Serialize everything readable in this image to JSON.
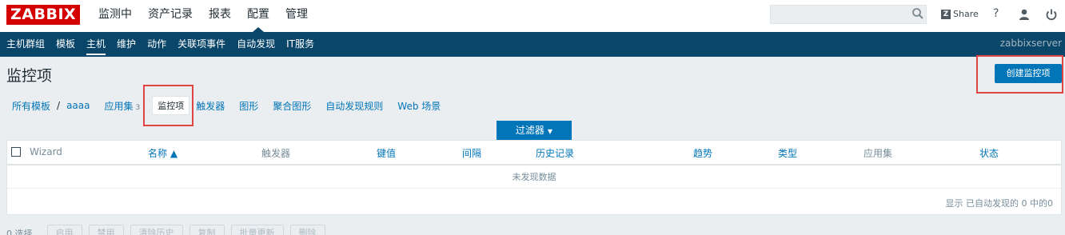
{
  "logo": "ZABBIX",
  "top_nav": [
    "监测中",
    "资产记录",
    "报表",
    "配置",
    "管理"
  ],
  "top_nav_active": "配置",
  "search": {
    "value": "",
    "placeholder": ""
  },
  "share_label": "Share",
  "help_label": "?",
  "sub_nav": [
    "主机群组",
    "模板",
    "主机",
    "维护",
    "动作",
    "关联项事件",
    "自动发现",
    "IT服务"
  ],
  "sub_nav_active": "主机",
  "server_name": "zabbixserver",
  "page_title": "监控项",
  "create_button": "创建监控项",
  "breadcrumb": {
    "all_templates": "所有模板",
    "separator": "/",
    "host": "aaaa",
    "applications": "应用集",
    "applications_count": "3",
    "items": "监控项",
    "triggers": "触发器",
    "graphs": "图形",
    "screens": "聚合图形",
    "discovery": "自动发现规则",
    "web": "Web 场景"
  },
  "filter_label": "过滤器",
  "table": {
    "columns": [
      "Wizard",
      "名称 ▲",
      "触发器",
      "键值",
      "间隔",
      "历史记录",
      "趋势",
      "类型",
      "应用集",
      "状态"
    ],
    "empty_text": "未发现数据",
    "footer_text": "显示 已自动发现的 0 中的0"
  },
  "bottom": {
    "selected": "0 选择",
    "buttons": [
      "启用",
      "禁用",
      "清除历史",
      "复制",
      "批量更新",
      "删除"
    ]
  },
  "colors": {
    "brand": "#d40000",
    "subnav_bg": "#0a466a",
    "accent": "#0275b8",
    "highlight_box": "#e04444"
  }
}
